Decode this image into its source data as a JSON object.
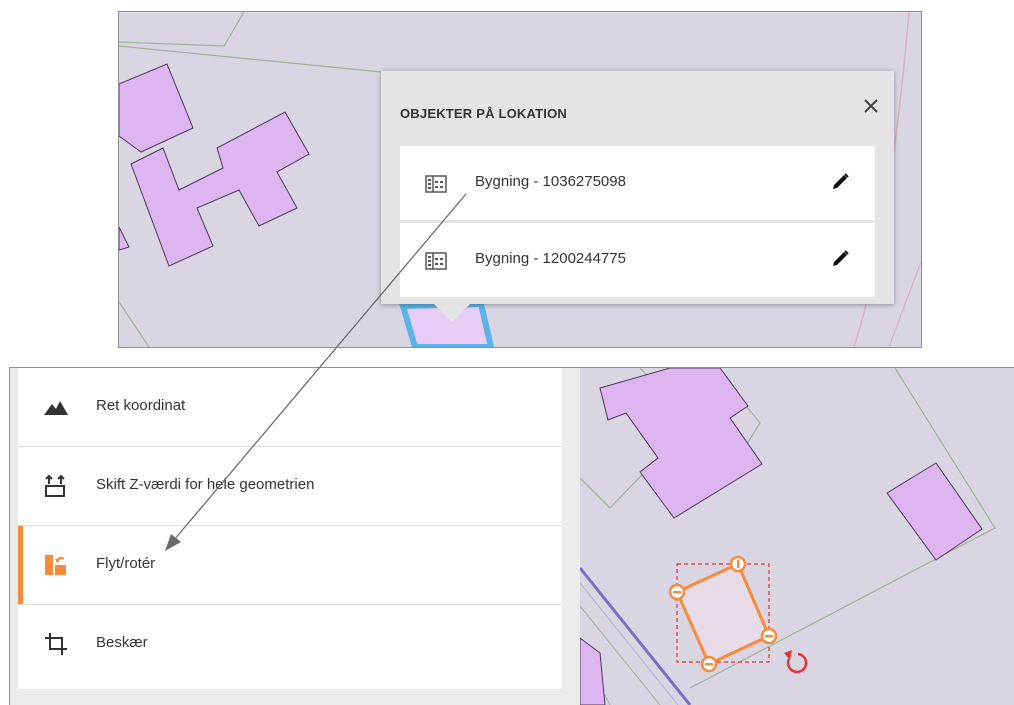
{
  "popup": {
    "title": "OBJEKTER PÅ LOKATION",
    "objects": [
      {
        "label": "Bygning - 1036275098"
      },
      {
        "label": "Bygning - 1200244775"
      }
    ]
  },
  "tools_menu": {
    "items": [
      {
        "label": "Ret koordinat",
        "icon": "mountain-icon",
        "active": false
      },
      {
        "label": "Skift Z-værdi for hele geometrien",
        "icon": "z-value-icon",
        "active": false
      },
      {
        "label": "Flyt/rotér",
        "icon": "move-rotate-icon",
        "active": true
      },
      {
        "label": "Beskær",
        "icon": "crop-icon",
        "active": false
      }
    ]
  },
  "colors": {
    "building_fill": "#dcb5f1",
    "building_stroke": "#4d3b5c",
    "map_background": "#d9d5e2",
    "accent": "#f78a3b",
    "selection_outline": "#e03535",
    "highlight_outline": "#5ab4ea"
  }
}
